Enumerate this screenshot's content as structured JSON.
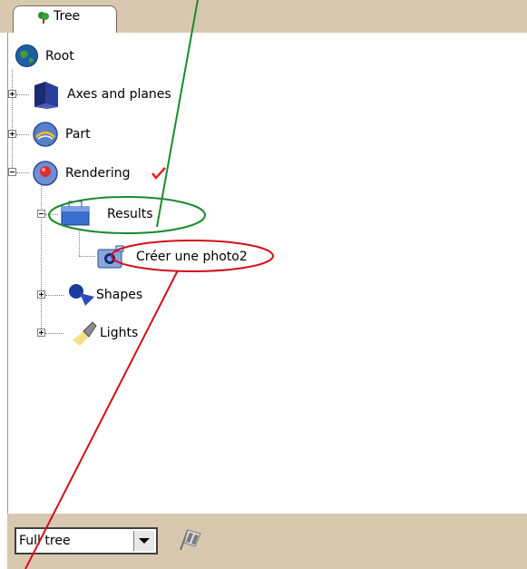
{
  "tab": {
    "label": "Tree",
    "icon": "tree-icon"
  },
  "tree": {
    "root": "Root",
    "items": {
      "axes": "Axes and planes",
      "part": "Part",
      "rendering": "Rendering",
      "results": "Results",
      "photo": "Créer une photo2",
      "shapes": "Shapes",
      "lights": "Lights"
    }
  },
  "footer": {
    "filter_value": "Full tree"
  },
  "colors": {
    "chrome": "#d8c8b0",
    "green_annotation": "#1a8a2e",
    "red_annotation": "#d0101c",
    "check": "#e02020"
  }
}
